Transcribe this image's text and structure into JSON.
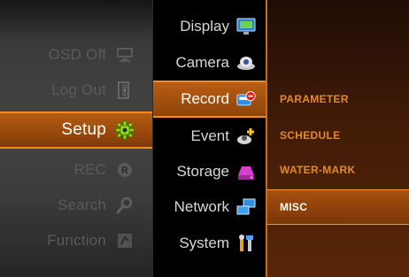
{
  "left_menu": {
    "items": [
      {
        "label": "OSD Off",
        "icon": "monitor-icon"
      },
      {
        "label": "Log Out",
        "icon": "logout-icon"
      },
      {
        "label": "Setup",
        "icon": "gear-icon",
        "active": true
      },
      {
        "label": "REC",
        "icon": "record-r-icon"
      },
      {
        "label": "Search",
        "icon": "magnifier-icon"
      },
      {
        "label": "Function",
        "icon": "function-icon"
      }
    ]
  },
  "setup_menu": {
    "items": [
      {
        "label": "Display",
        "icon": "display-icon"
      },
      {
        "label": "Camera",
        "icon": "camera-icon"
      },
      {
        "label": "Record",
        "icon": "record-icon",
        "active": true
      },
      {
        "label": "Event",
        "icon": "event-icon"
      },
      {
        "label": "Storage",
        "icon": "storage-icon"
      },
      {
        "label": "Network",
        "icon": "network-icon"
      },
      {
        "label": "System",
        "icon": "tools-icon"
      }
    ]
  },
  "record_menu": {
    "items": [
      {
        "label": "PARAMETER"
      },
      {
        "label": "SCHEDULE"
      },
      {
        "label": "WATER-MARK"
      },
      {
        "label": "MISC",
        "active": true
      }
    ]
  },
  "colors": {
    "accent": "#ff8a1a",
    "active_fill": "#a6500f",
    "submenu_text": "#e08a2a"
  }
}
